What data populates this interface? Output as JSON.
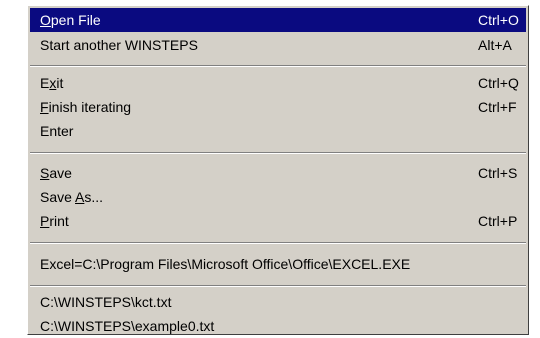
{
  "menu": {
    "items": [
      {
        "pre": "",
        "ul": "O",
        "post": "pen File",
        "shortcut": "Ctrl+O"
      },
      {
        "pre": "Start another WINSTEPS",
        "ul": "",
        "post": "",
        "shortcut": "Alt+A"
      },
      {
        "pre": "E",
        "ul": "x",
        "post": "it",
        "shortcut": "Ctrl+Q"
      },
      {
        "pre": "",
        "ul": "F",
        "post": "inish iterating",
        "shortcut": "Ctrl+F"
      },
      {
        "pre": "Enter",
        "ul": "",
        "post": "",
        "shortcut": ""
      },
      {
        "pre": "",
        "ul": "S",
        "post": "ave",
        "shortcut": "Ctrl+S"
      },
      {
        "pre": "Save ",
        "ul": "A",
        "post": "s...",
        "shortcut": ""
      },
      {
        "pre": "",
        "ul": "P",
        "post": "rint",
        "shortcut": "Ctrl+P"
      },
      {
        "pre": "Excel=C:\\Program Files\\Microsoft Office\\Office\\EXCEL.EXE",
        "ul": "",
        "post": "",
        "shortcut": ""
      },
      {
        "pre": "C:\\WINSTEPS\\kct.txt",
        "ul": "",
        "post": "",
        "shortcut": ""
      },
      {
        "pre": "C:\\WINSTEPS\\example0.txt",
        "ul": "",
        "post": "",
        "shortcut": ""
      }
    ]
  },
  "colors": {
    "menu_background": "#d4d0c8",
    "highlight_background": "#0a0a80",
    "highlight_text": "#ffffff",
    "text": "#000000"
  }
}
